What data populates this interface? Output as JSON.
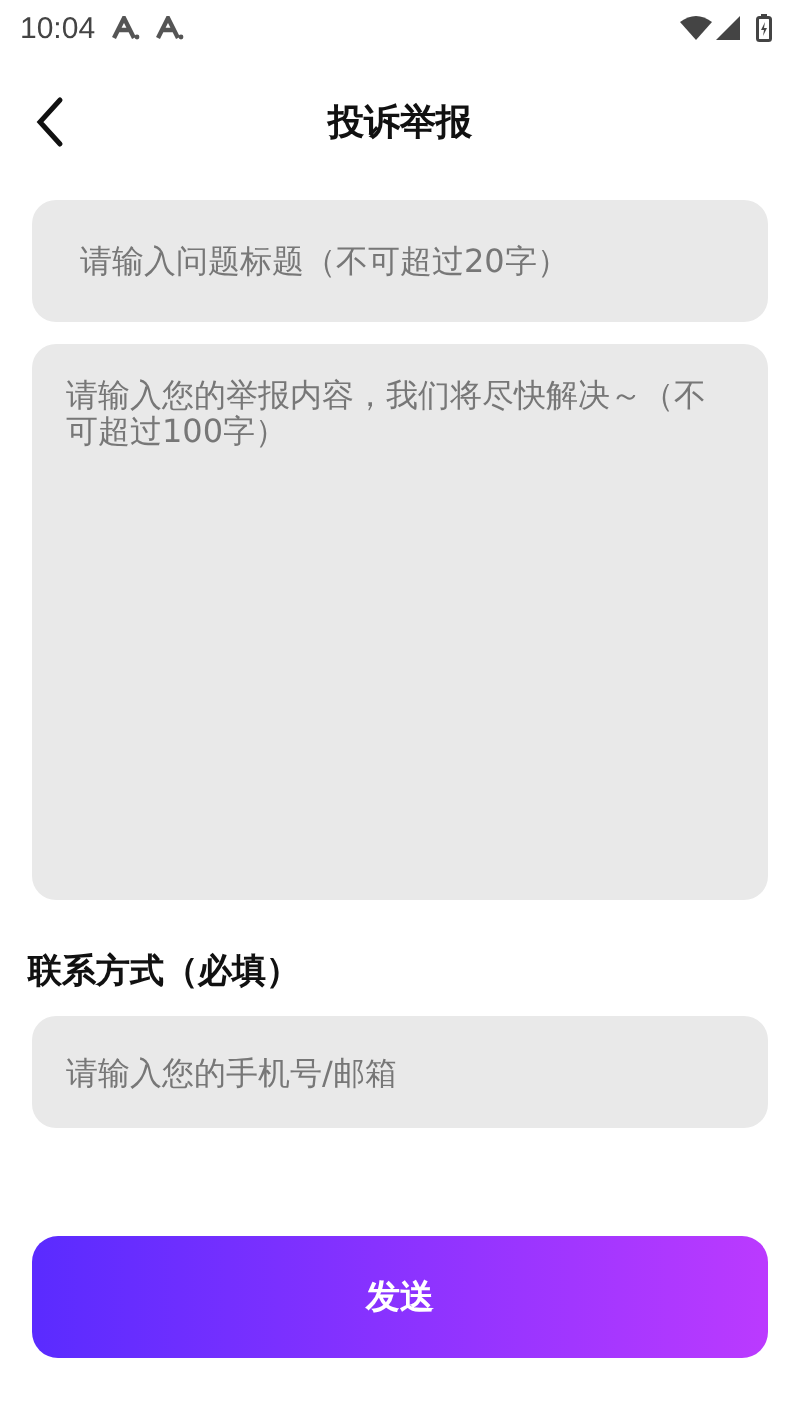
{
  "status_bar": {
    "time": "10:04"
  },
  "header": {
    "title": "投诉举报"
  },
  "title_field": {
    "placeholder": "请输入问题标题（不可超过20字）"
  },
  "content_field": {
    "placeholder": "请输入您的举报内容，我们将尽快解决～（不可超过100字）"
  },
  "contact_label": "联系方式（必填）",
  "contact_field": {
    "placeholder": "请输入您的手机号/邮箱"
  },
  "submit_button": "发送"
}
